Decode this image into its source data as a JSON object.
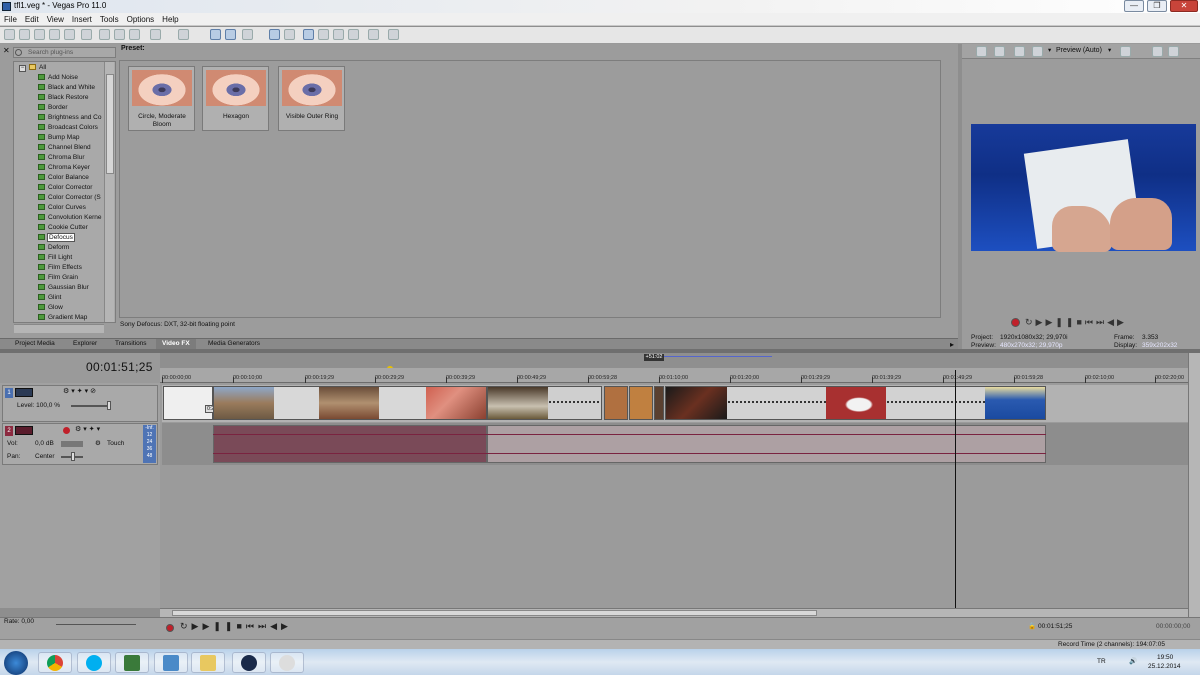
{
  "window": {
    "title": "tfl1.veg * - Vegas Pro 11.0",
    "min_glyph": "—",
    "max_glyph": "❐",
    "close_glyph": "✕"
  },
  "menu": [
    "File",
    "Edit",
    "View",
    "Insert",
    "Tools",
    "Options",
    "Help"
  ],
  "plugin_panel": {
    "search_placeholder": "Search plug-ins",
    "tree_root": "All",
    "items": [
      "Add Noise",
      "Black and White",
      "Black Restore",
      "Border",
      "Brightness and Co",
      "Broadcast Colors",
      "Bump Map",
      "Channel Blend",
      "Chroma Blur",
      "Chroma Keyer",
      "Color Balance",
      "Color Corrector",
      "Color Corrector (S",
      "Color Curves",
      "Convolution Kerne",
      "Cookie Cutter",
      "Defocus",
      "Deform",
      "Fill Light",
      "Film Effects",
      "Film Grain",
      "Gaussian Blur",
      "Glint",
      "Glow",
      "Gradient Map"
    ],
    "selected": "Defocus",
    "preset_label": "Preset:",
    "presets": [
      "Circle, Moderate Bloom",
      "Hexagon",
      "Visible Outer Ring"
    ],
    "description": "Sony Defocus: DXT, 32-bit floating point"
  },
  "dock_tabs": [
    "Project Media",
    "Explorer",
    "Transitions",
    "Video FX",
    "Media Generators"
  ],
  "dock_active_tab": "Video FX",
  "preview": {
    "mode_label": "Preview (Auto)",
    "project_label": "Project:",
    "project_value": "1920x1080x32; 29,970i",
    "preview_label": "Preview:",
    "preview_value": "480x270x32; 29,970p",
    "frame_label": "Frame:",
    "frame_value": "3.353",
    "display_label": "Display:",
    "display_value": "359x202x32"
  },
  "timeline": {
    "timecode": "00:01:51;25",
    "region_marker": "+51:02",
    "ruler_ticks": [
      "00:00:00;00",
      "00:00:10;00",
      "00:00:19;29",
      "00:00:29;29",
      "00:00:39;29",
      "00:00:49;29",
      "00:00:59;28",
      "00:01:10;00",
      "00:01:20;00",
      "00:01:29;29",
      "00:01:39;29",
      "00:01:49;29",
      "00:01:59;28",
      "00:02:10;00",
      "00:02:20;00"
    ],
    "clip_event_label": "0:26",
    "video_track": {
      "number": "1",
      "level_label": "Level: 100,0 %"
    },
    "audio_track": {
      "number": "2",
      "vol_label": "Vol:",
      "vol_value": "0,0 dB",
      "pan_label": "Pan:",
      "pan_value": "Center",
      "mode": "Touch",
      "meter_labels": [
        "-Inf.",
        "12",
        "24",
        "36",
        "48"
      ]
    }
  },
  "transport": {
    "rate_label": "Rate: 0,00",
    "cursor_time": "00:01:51;25",
    "end_time": "00:00:00;00"
  },
  "status": {
    "record_time": "Record Time (2 channels): 194:07:05"
  },
  "taskbar": {
    "lang": "TR",
    "time": "19:50",
    "date": "25.12.2014"
  }
}
